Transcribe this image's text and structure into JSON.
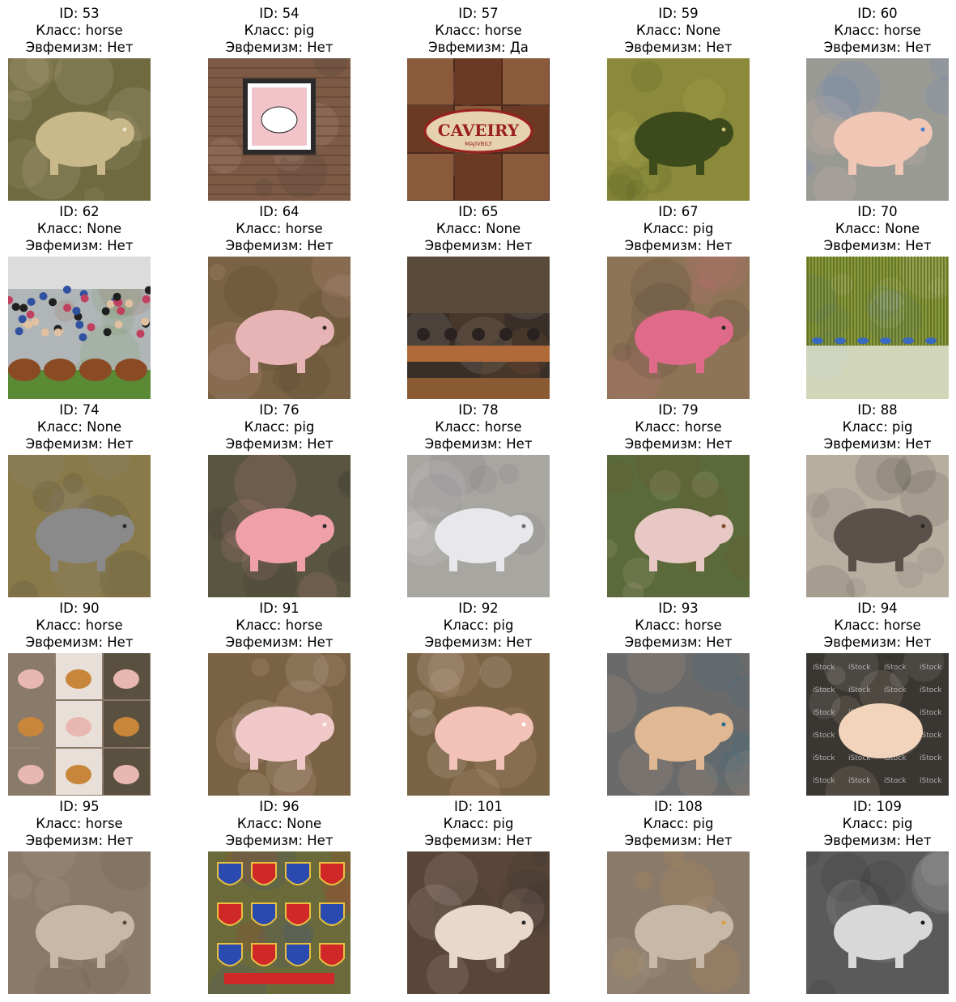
{
  "labels": {
    "id": "ID: ",
    "class": "Класс: ",
    "euphemism": "Эвфемизм: "
  },
  "items": [
    {
      "id": "53",
      "class": "horse",
      "euphemism": "Нет",
      "image": "cream-colored-furry-animal-on-dirt",
      "palette": [
        "#6f6a40",
        "#c9b98a",
        "#ece2cf"
      ]
    },
    {
      "id": "54",
      "class": "pig",
      "euphemism": "Нет",
      "image": "framed-pig-drawing-on-brick-wall",
      "palette": [
        "#7c5a45",
        "#f2c4c9",
        "#2a2a2a"
      ]
    },
    {
      "id": "57",
      "class": "horse",
      "euphemism": "Да",
      "image": "restaurant-food-collage-with-sign",
      "palette": [
        "#4a2a1e",
        "#e6d2b0",
        "#9a1f1f"
      ],
      "sign_text": "CAVEIRY",
      "sign_sub": "MAJIVBILY"
    },
    {
      "id": "59",
      "class": "None",
      "euphemism": "Нет",
      "image": "overgrown-stone-ruins",
      "palette": [
        "#8a8a3a",
        "#3d4a1c",
        "#c9c26a"
      ]
    },
    {
      "id": "60",
      "class": "horse",
      "euphemism": "Нет",
      "image": "pig-sticker-on-metal-fence",
      "palette": [
        "#9a9a94",
        "#f0c6b4",
        "#4a7fd0"
      ]
    },
    {
      "id": "62",
      "class": "None",
      "euphemism": "Нет",
      "image": "crowd-at-cattle-fair",
      "palette": [
        "#b0b5b8",
        "#8a4a24",
        "#5a8a34"
      ]
    },
    {
      "id": "64",
      "class": "horse",
      "euphemism": "Нет",
      "image": "painted-pig-face-on-cardboard",
      "palette": [
        "#7a6244",
        "#e6b4b4",
        "#3a2e24"
      ]
    },
    {
      "id": "65",
      "class": "None",
      "euphemism": "Нет",
      "image": "coffee-shop-interior",
      "palette": [
        "#3a2f28",
        "#b06a3a",
        "#cfcfc8"
      ]
    },
    {
      "id": "67",
      "class": "pig",
      "euphemism": "Нет",
      "image": "quilled-paper-pig",
      "palette": [
        "#8e7456",
        "#e06a8a",
        "#2a2a28"
      ]
    },
    {
      "id": "70",
      "class": "None",
      "euphemism": "Нет",
      "image": "reeds-and-birds-by-water",
      "palette": [
        "#8a9a3a",
        "#3a6abf",
        "#f0f0f0"
      ]
    },
    {
      "id": "74",
      "class": "None",
      "euphemism": "Нет",
      "image": "raccoon-in-grass",
      "palette": [
        "#8a7a4a",
        "#8a8a8a",
        "#2a2a2a"
      ]
    },
    {
      "id": "76",
      "class": "pig",
      "euphemism": "Нет",
      "image": "cross-stitch-pig",
      "palette": [
        "#5a5540",
        "#f0a0a8",
        "#2a2a2a"
      ]
    },
    {
      "id": "78",
      "class": "horse",
      "euphemism": "Нет",
      "image": "chrome-animal-sculpture",
      "palette": [
        "#a8a6a0",
        "#e8e8ec",
        "#6a6a70"
      ]
    },
    {
      "id": "79",
      "class": "horse",
      "euphemism": "Нет",
      "image": "pig-in-forest",
      "palette": [
        "#5a6a3a",
        "#e8c8c4",
        "#7a4a2a"
      ]
    },
    {
      "id": "88",
      "class": "pig",
      "euphemism": "Нет",
      "image": "pencil-sketch-of-boar",
      "palette": [
        "#b8aea0",
        "#5a524a",
        "#2a2622"
      ]
    },
    {
      "id": "90",
      "class": "horse",
      "euphemism": "Нет",
      "image": "collage-of-pigs-and-animals",
      "palette": [
        "#8a7a6a",
        "#e8b8b0",
        "#c8863a"
      ]
    },
    {
      "id": "91",
      "class": "horse",
      "euphemism": "Нет",
      "image": "quilled-paper-sheep",
      "palette": [
        "#7a6244",
        "#f0c8c8",
        "#f8f4f0"
      ]
    },
    {
      "id": "92",
      "class": "pig",
      "euphemism": "Нет",
      "image": "pink-pig-on-brown-background",
      "palette": [
        "#7a6244",
        "#f2c2b8",
        "#ffffff"
      ]
    },
    {
      "id": "93",
      "class": "horse",
      "euphemism": "Нет",
      "image": "cartoon-robot-vehicle",
      "palette": [
        "#6a6a6a",
        "#e0b894",
        "#2a6a8a"
      ]
    },
    {
      "id": "94",
      "class": "horse",
      "euphemism": "Нет",
      "image": "stock-pig-icons-sheet",
      "palette": [
        "#3a3632",
        "#f2d4bc",
        "#d0d0d0"
      ],
      "watermark": "iStock"
    },
    {
      "id": "95",
      "class": "horse",
      "euphemism": "Нет",
      "image": "stone-relief-of-animal",
      "palette": [
        "#8a7a6a",
        "#c8b8a8",
        "#5a4a3a"
      ]
    },
    {
      "id": "96",
      "class": "None",
      "euphemism": "Нет",
      "image": "heraldic-shields-collection",
      "palette": [
        "#6a6a3a",
        "#d02828",
        "#2a4ab0"
      ]
    },
    {
      "id": "101",
      "class": "pig",
      "euphemism": "Нет",
      "image": "small-fluffy-pig-figurine",
      "palette": [
        "#5a4638",
        "#e8d8cc",
        "#2a2a2a"
      ]
    },
    {
      "id": "108",
      "class": "pig",
      "euphemism": "Нет",
      "image": "herd-of-pigs-sketch",
      "palette": [
        "#8a7a6a",
        "#c8b8a8",
        "#d8a040"
      ]
    },
    {
      "id": "109",
      "class": "pig",
      "euphemism": "Нет",
      "image": "woodcut-style-pig",
      "palette": [
        "#5a5a5a",
        "#d8d8d8",
        "#1a1a1a"
      ]
    }
  ]
}
